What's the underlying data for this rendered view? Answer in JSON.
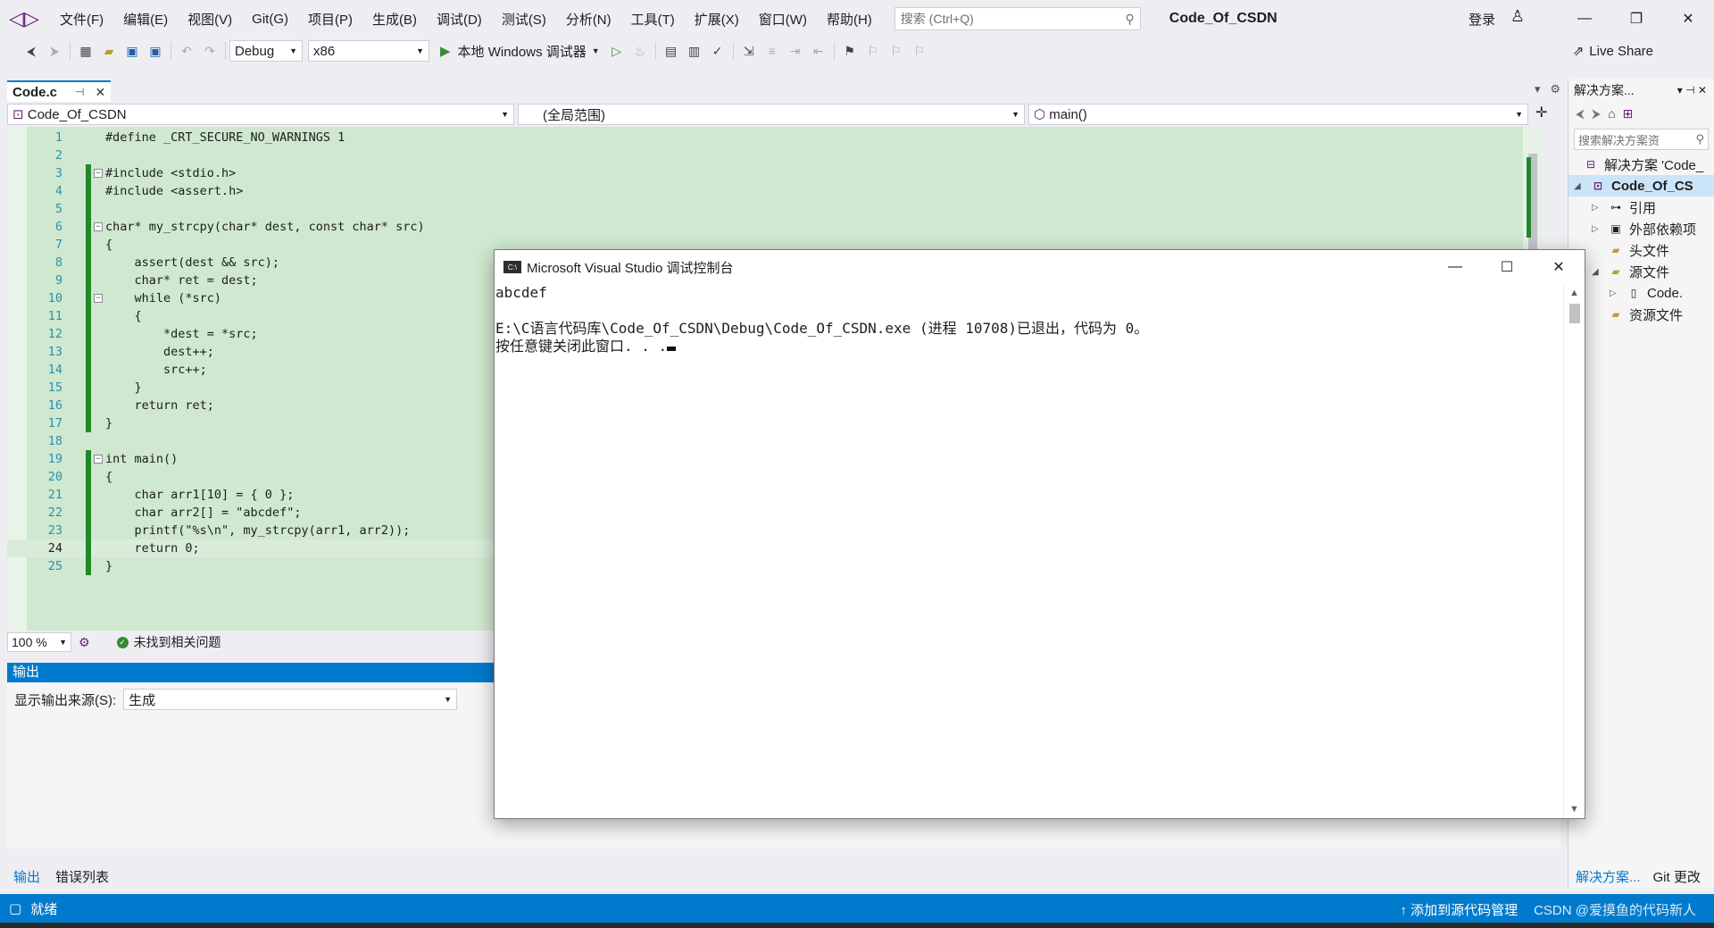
{
  "menubar": {
    "items": [
      "文件(F)",
      "编辑(E)",
      "视图(V)",
      "Git(G)",
      "项目(P)",
      "生成(B)",
      "调试(D)",
      "测试(S)",
      "分析(N)",
      "工具(T)",
      "扩展(X)",
      "窗口(W)",
      "帮助(H)"
    ],
    "search_placeholder": "搜索 (Ctrl+Q)",
    "solution_title": "Code_Of_CSDN",
    "signin": "登录"
  },
  "toolbar": {
    "config": "Debug",
    "platform": "x86",
    "run_label": "本地 Windows 调试器",
    "liveshare": "Live Share"
  },
  "editor_tab": {
    "name": "Code.c"
  },
  "navbar": {
    "project": "Code_Of_CSDN",
    "scope": "(全局范围)",
    "member": "main()"
  },
  "code": {
    "current_line": 24,
    "lines": [
      {
        "n": "1",
        "text": "#define _CRT_SECURE_NO_WARNINGS 1"
      },
      {
        "n": "2",
        "text": ""
      },
      {
        "n": "3",
        "text": "#include <stdio.h>"
      },
      {
        "n": "4",
        "text": "#include <assert.h>"
      },
      {
        "n": "5",
        "text": ""
      },
      {
        "n": "6",
        "text": "char* my_strcpy(char* dest, const char* src)"
      },
      {
        "n": "7",
        "text": "{"
      },
      {
        "n": "8",
        "text": "    assert(dest && src);"
      },
      {
        "n": "9",
        "text": "    char* ret = dest;"
      },
      {
        "n": "10",
        "text": "    while (*src)"
      },
      {
        "n": "11",
        "text": "    {"
      },
      {
        "n": "12",
        "text": "        *dest = *src;"
      },
      {
        "n": "13",
        "text": "        dest++;"
      },
      {
        "n": "14",
        "text": "        src++;"
      },
      {
        "n": "15",
        "text": "    }"
      },
      {
        "n": "16",
        "text": "    return ret;"
      },
      {
        "n": "17",
        "text": "}"
      },
      {
        "n": "18",
        "text": ""
      },
      {
        "n": "19",
        "text": "int main()"
      },
      {
        "n": "20",
        "text": "{"
      },
      {
        "n": "21",
        "text": "    char arr1[10] = { 0 };"
      },
      {
        "n": "22",
        "text": "    char arr2[] = \"abcdef\";"
      },
      {
        "n": "23",
        "text": "    printf(\"%s\\n\", my_strcpy(arr1, arr2));"
      },
      {
        "n": "24",
        "text": "    return 0;"
      },
      {
        "n": "25",
        "text": "}"
      }
    ]
  },
  "editor_status": {
    "zoom": "100 %",
    "issues": "未找到相关问题"
  },
  "output": {
    "title": "输出",
    "source_label": "显示输出来源(S):",
    "source_value": "生成",
    "tabs": [
      "输出",
      "错误列表"
    ]
  },
  "solution_explorer": {
    "title": "解决方案...",
    "search_placeholder": "搜索解决方案资",
    "items": [
      {
        "label": "解决方案 'Code_"
      },
      {
        "label": "Code_Of_CS"
      },
      {
        "label": "引用"
      },
      {
        "label": "外部依赖项"
      },
      {
        "label": "头文件"
      },
      {
        "label": "源文件"
      },
      {
        "label": "Code."
      },
      {
        "label": "资源文件"
      }
    ],
    "bottom_tabs": [
      "解决方案...",
      "Git 更改"
    ]
  },
  "statusbar": {
    "ready": "就绪",
    "source_control": "添加到源代码管理",
    "watermark": "CSDN @爱摸鱼的代码新人"
  },
  "console": {
    "title": "Microsoft Visual Studio 调试控制台",
    "lines": [
      "abcdef",
      "",
      "E:\\C语言代码库\\Code_Of_CSDN\\Debug\\Code_Of_CSDN.exe (进程 10708)已退出，代码为 0。",
      "按任意键关闭此窗口. . ."
    ]
  },
  "colors": {
    "accent": "#007acc",
    "editor_bg": "#cfe8cf",
    "keyword": "#0000ff",
    "string": "#a31515",
    "change_bar": "#22882a"
  }
}
